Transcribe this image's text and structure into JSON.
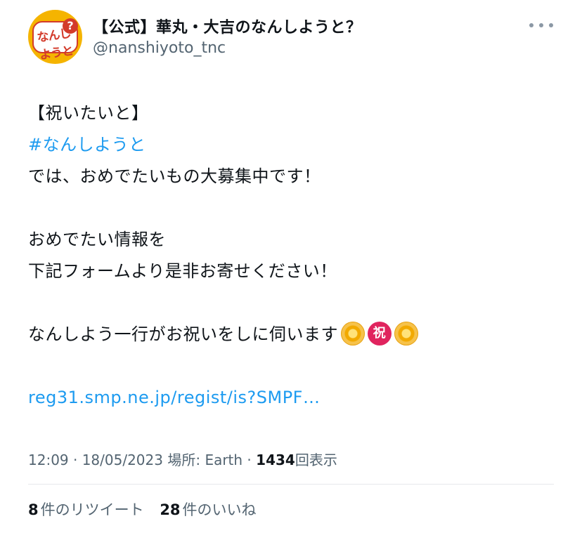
{
  "author": {
    "display_name": "【公式】華丸・大吉のなんしようと？",
    "handle": "@nanshiyoto_tnc",
    "avatar_text": "なんしようと"
  },
  "tweet": {
    "line1": "【祝いたいと】",
    "hashtag": "#なんしようと",
    "line3": "では、おめでたいもの大募集中です！",
    "line5": "おめでたい情報を",
    "line6": "下記フォームより是非お寄せください！",
    "line8": "なんしよう一行がお祝いをしに伺います",
    "emoji_iwai": "祝",
    "link": "reg31.smp.ne.jp/regist/is?SMPF…"
  },
  "meta": {
    "time_date": "12:09 · 18/05/2023",
    "location_label": "場所: Earth ·",
    "views_count": "1434",
    "views_label": "回表示"
  },
  "stats": {
    "retweets_count": "8",
    "retweets_label": "件のリツイート",
    "likes_count": "28",
    "likes_label": "件のいいね"
  },
  "colors": {
    "link": "#1d9bf0",
    "secondary_text": "#536471",
    "avatar_bg": "#f5b400"
  }
}
